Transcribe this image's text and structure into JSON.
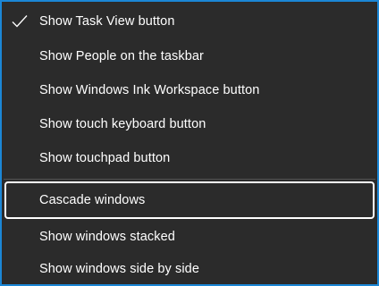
{
  "menu": {
    "items": [
      {
        "label": "Show Task View button",
        "checked": true
      },
      {
        "label": "Show People on the taskbar",
        "checked": false
      },
      {
        "label": "Show Windows Ink Workspace button",
        "checked": false
      },
      {
        "label": "Show touch keyboard button",
        "checked": false
      },
      {
        "label": "Show touchpad button",
        "checked": false
      }
    ],
    "window_items": [
      {
        "label": "Cascade windows",
        "highlighted": true
      },
      {
        "label": "Show windows stacked",
        "highlighted": false
      },
      {
        "label": "Show windows side by side",
        "highlighted": false
      }
    ],
    "check_icon": "checkmark-icon",
    "colors": {
      "background": "#2b2b2b",
      "border": "#1b87d6",
      "text": "#ffffff",
      "focus_outline": "#ffffff"
    }
  }
}
